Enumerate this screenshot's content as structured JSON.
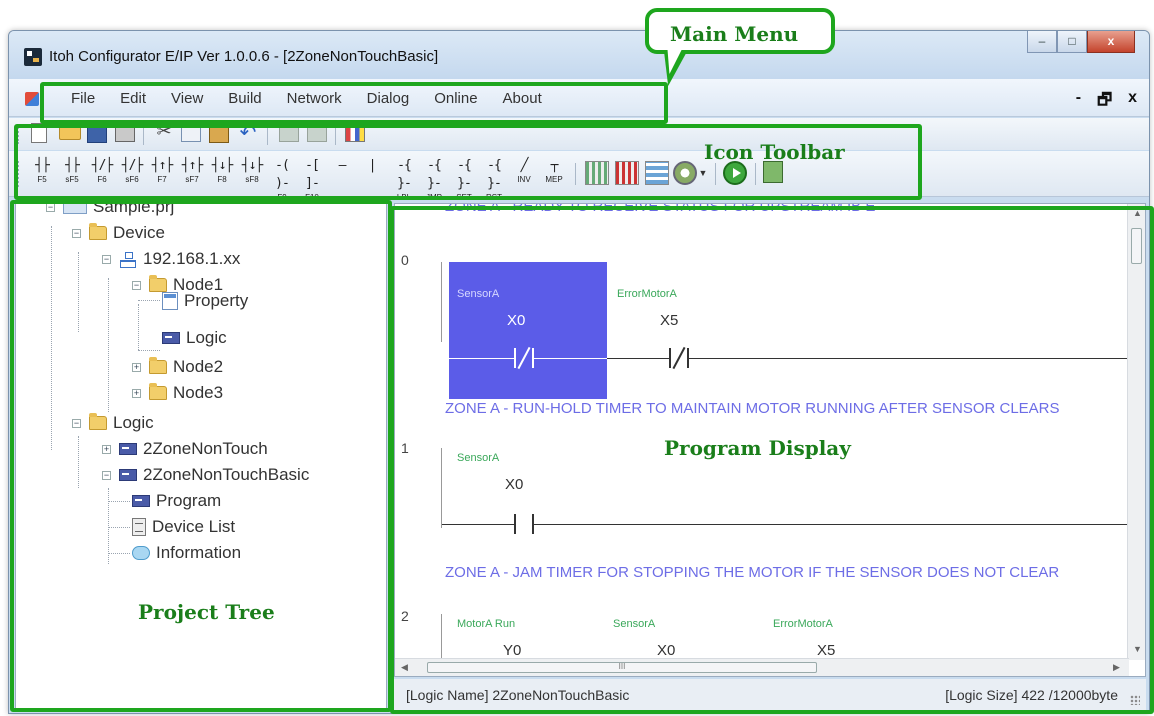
{
  "window": {
    "title": "Itoh Configurator E/IP Ver 1.0.0.6 - [2ZoneNonTouchBasic]",
    "controls": {
      "minimize": "–",
      "maximize": "□",
      "close": "x"
    }
  },
  "menu": {
    "items": [
      "File",
      "Edit",
      "View",
      "Build",
      "Network",
      "Dialog",
      "Online",
      "About"
    ],
    "mdi_controls": {
      "minimize": "-",
      "restore": "🗗",
      "close": "x"
    }
  },
  "toolbar": {
    "ladder_buttons": [
      {
        "symbol": "┤├",
        "key": "F5"
      },
      {
        "symbol": "┤├",
        "key": "sF5"
      },
      {
        "symbol": "┤/├",
        "key": "F6"
      },
      {
        "symbol": "┤/├",
        "key": "sF6"
      },
      {
        "symbol": "┤↑├",
        "key": "F7"
      },
      {
        "symbol": "┤↑├",
        "key": "sF7"
      },
      {
        "symbol": "┤↓├",
        "key": "F8"
      },
      {
        "symbol": "┤↓├",
        "key": "sF8"
      },
      {
        "symbol": "-( )-",
        "key": "F9"
      },
      {
        "symbol": "-[ ]-",
        "key": "F10"
      },
      {
        "symbol": "—",
        "key": ""
      },
      {
        "symbol": "|",
        "key": ""
      },
      {
        "symbol": "-{ }-",
        "key": "LBL"
      },
      {
        "symbol": "-{ }-",
        "key": "JMP"
      },
      {
        "symbol": "-{ }-",
        "key": "SET"
      },
      {
        "symbol": "-{ }-",
        "key": "RST"
      },
      {
        "symbol": "╱",
        "key": "INV"
      },
      {
        "symbol": "┬",
        "key": "MEP"
      }
    ]
  },
  "tree": {
    "nodes": [
      {
        "label": "Sample.prj"
      },
      {
        "label": "Device"
      },
      {
        "label": "192.168.1.xx"
      },
      {
        "label": "Node1"
      },
      {
        "label": "Property"
      },
      {
        "label": "Logic"
      },
      {
        "label": "Node2"
      },
      {
        "label": "Node3"
      },
      {
        "label": "Logic"
      },
      {
        "label": "2ZoneNonTouch"
      },
      {
        "label": "2ZoneNonTouchBasic"
      },
      {
        "label": "Program"
      },
      {
        "label": "Device List"
      },
      {
        "label": "Information"
      }
    ]
  },
  "program": {
    "comments": [
      "ZONE A - READY TO RECEIVE STATUS FOR UPSTREAM IB E",
      "ZONE A - RUN-HOLD TIMER TO MAINTAIN MOTOR RUNNING AFTER SENSOR CLEARS",
      "ZONE A - JAM TIMER FOR STOPPING THE MOTOR IF THE SENSOR DOES NOT CLEAR"
    ],
    "rungs": [
      {
        "number": "0",
        "devices": [
          {
            "label": "SensorA",
            "address": "X0"
          },
          {
            "label": "ErrorMotorA",
            "address": "X5"
          }
        ]
      },
      {
        "number": "1",
        "devices": [
          {
            "label": "SensorA",
            "address": "X0"
          }
        ]
      },
      {
        "number": "2",
        "devices": [
          {
            "label": "MotorA Run",
            "address": "Y0"
          },
          {
            "label": "SensorA",
            "address": "X0"
          },
          {
            "label": "ErrorMotorA",
            "address": "X5"
          }
        ]
      }
    ],
    "hscroll_thumb": "III"
  },
  "status": {
    "logic_name_label": "[Logic Name]",
    "logic_name": "2ZoneNonTouchBasic",
    "logic_size_label": "[Logic Size]",
    "logic_size": "422",
    "logic_capacity": "/12000byte"
  },
  "annotations": {
    "main_menu": "Main Menu",
    "icon_toolbar": "Icon Toolbar",
    "project_tree": "Project Tree",
    "program_display": "Program Display",
    "highlight_color": "#1ea61e"
  },
  "colors": {
    "selection": "#5b5ce8",
    "comment_text": "#6d6de6",
    "device_label": "#3aa85a"
  }
}
